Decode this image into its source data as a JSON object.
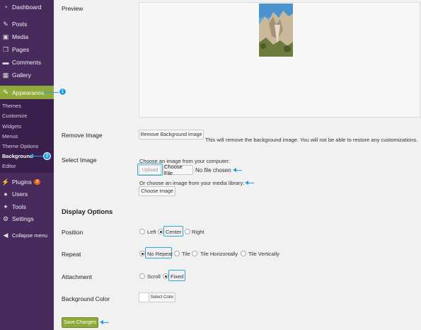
{
  "sidebar": {
    "items": [
      {
        "label": "Dashboard",
        "icon": "dashboard-icon",
        "glyph": "◔"
      },
      {
        "label": "Posts",
        "icon": "pin-icon",
        "glyph": "✎"
      },
      {
        "label": "Media",
        "icon": "media-icon",
        "glyph": "▣"
      },
      {
        "label": "Pages",
        "icon": "pages-icon",
        "glyph": "❐"
      },
      {
        "label": "Comments",
        "icon": "comment-icon",
        "glyph": "▬"
      },
      {
        "label": "Gallery",
        "icon": "gallery-icon",
        "glyph": "▦"
      },
      {
        "label": "Appearance",
        "icon": "brush-icon",
        "glyph": "✎"
      },
      {
        "label": "Plugins",
        "icon": "plugin-icon",
        "glyph": "⚡",
        "badge": "3"
      },
      {
        "label": "Users",
        "icon": "user-icon",
        "glyph": "●"
      },
      {
        "label": "Tools",
        "icon": "wrench-icon",
        "glyph": "✦"
      },
      {
        "label": "Settings",
        "icon": "settings-icon",
        "glyph": "⚙"
      },
      {
        "label": "Collapse menu",
        "icon": "collapse-icon",
        "glyph": "◀"
      }
    ],
    "submenu": [
      "Themes",
      "Customize",
      "Widgets",
      "Menus",
      "Theme Options",
      "Background",
      "Editor"
    ],
    "callouts": [
      "1",
      "2"
    ]
  },
  "main": {
    "preview_label": "Preview",
    "remove_image_label": "Remove Image",
    "remove_button": "Remove Background Image",
    "remove_desc": "This will remove the background image. You will not be able to restore any customizations.",
    "select_image_label": "Select Image",
    "choose_computer": "Choose an image from your computer:",
    "upload_button": "Upload",
    "choose_file_button": "Choose File",
    "no_file": "No file chosen",
    "choose_library": "Or choose an image from your media library:",
    "choose_image_button": "Choose Image",
    "display_options": "Display Options",
    "position_label": "Position",
    "position_options": [
      "Left",
      "Center",
      "Right"
    ],
    "repeat_label": "Repeat",
    "repeat_options": [
      "No Repeat",
      "Tile",
      "Tile Horizontally",
      "Tile Vertically"
    ],
    "attachment_label": "Attachment",
    "attachment_options": [
      "Scroll",
      "Fixed"
    ],
    "bg_color_label": "Background Color",
    "select_color_button": "Select Color",
    "save_button": "Save Changes"
  },
  "colors": {
    "sidebar_bg": "#482b5c",
    "active_item": "#8fa93a",
    "highlight": "#2ea7df"
  }
}
